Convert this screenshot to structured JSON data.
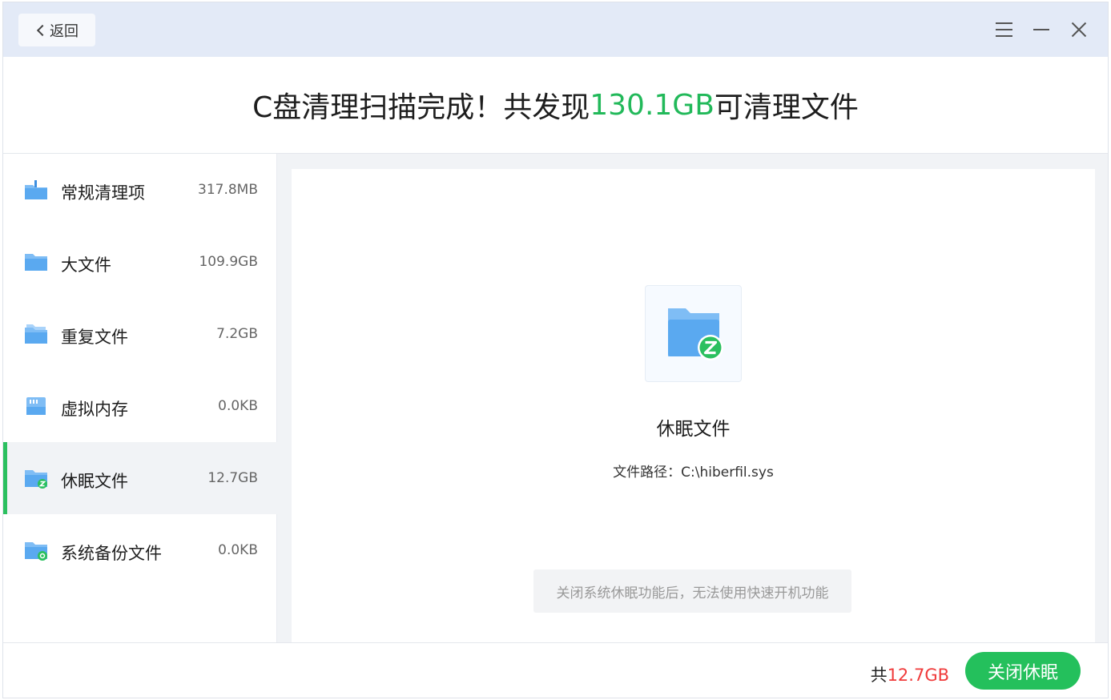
{
  "titlebar": {
    "back_label": "返回"
  },
  "heading": {
    "prefix": "C盘清理扫描完成！共发现",
    "amount": "130.1GB",
    "suffix": "可清理文件",
    "accent_color": "#22b95a"
  },
  "sidebar": {
    "items": [
      {
        "label": "常规清理项",
        "size": "317.8MB",
        "icon": "broom-folder-icon"
      },
      {
        "label": "大文件",
        "size": "109.9GB",
        "icon": "folder-icon"
      },
      {
        "label": "重复文件",
        "size": "7.2GB",
        "icon": "duplicate-folder-icon"
      },
      {
        "label": "虚拟内存",
        "size": "0.0KB",
        "icon": "memory-card-icon"
      },
      {
        "label": "休眠文件",
        "size": "12.7GB",
        "icon": "sleep-folder-icon",
        "active": true
      },
      {
        "label": "系统备份文件",
        "size": "0.0KB",
        "icon": "backup-folder-icon"
      }
    ],
    "active_color": "#2bc05f"
  },
  "detail": {
    "title": "休眠文件",
    "path_label": "文件路径：",
    "path_value": "C:\\hiberfil.sys",
    "notice": "关闭系统休眠功能后，无法使用快速开机功能"
  },
  "footer": {
    "total_prefix": "共",
    "total_amount": "12.7GB",
    "action_label": "关闭休眠",
    "action_color": "#24c05c",
    "amount_color": "#f03a3a"
  }
}
